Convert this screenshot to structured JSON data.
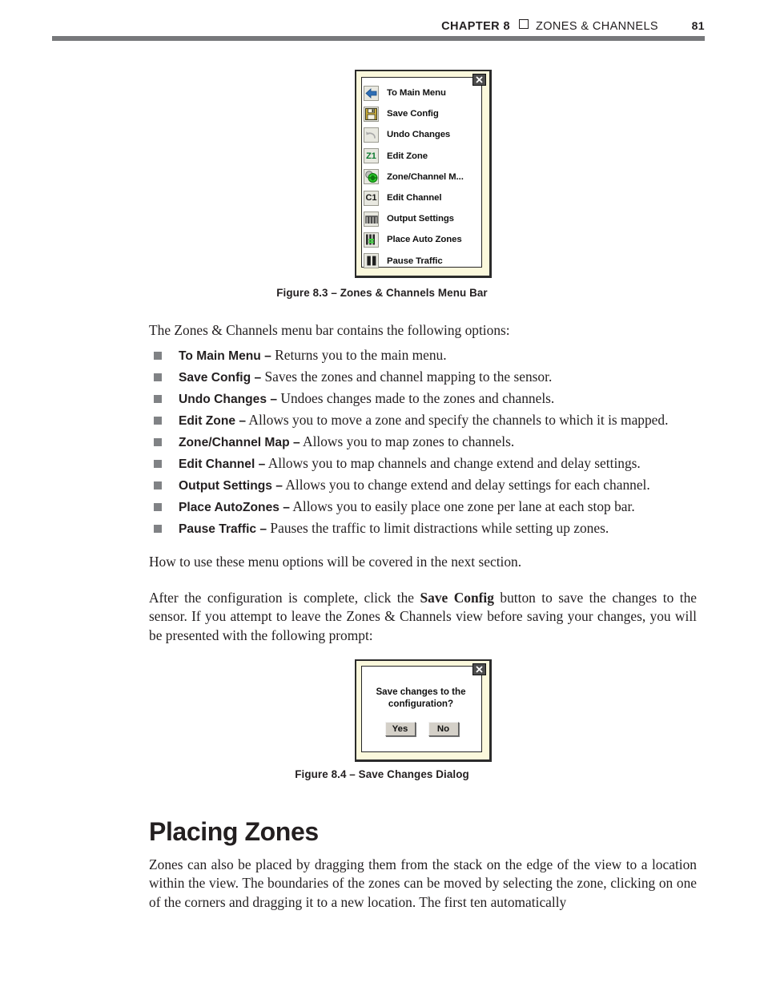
{
  "header": {
    "chapter": "CHAPTER 8",
    "separator_icon": "square-outline-icon",
    "title": "ZONES & CHANNELS",
    "page_number": "81"
  },
  "figure_menu": {
    "close_icon": "close-icon",
    "items": [
      {
        "icon": "back-arrow-icon",
        "icon_text": "",
        "label": "To Main Menu"
      },
      {
        "icon": "floppy-save-icon",
        "icon_text": "",
        "label": "Save Config"
      },
      {
        "icon": "undo-arrow-icon",
        "icon_text": "",
        "label": "Undo Changes"
      },
      {
        "icon": "zone-z1-icon",
        "icon_text": "Z1",
        "label": "Edit Zone"
      },
      {
        "icon": "zone-channel-map-icon",
        "icon_text": "",
        "label": "Zone/Channel M..."
      },
      {
        "icon": "channel-c1-icon",
        "icon_text": "C1",
        "label": "Edit Channel"
      },
      {
        "icon": "output-settings-icon",
        "icon_text": "",
        "label": "Output Settings"
      },
      {
        "icon": "place-auto-zones-icon",
        "icon_text": "",
        "label": "Place Auto Zones"
      },
      {
        "icon": "pause-traffic-icon",
        "icon_text": "",
        "label": "Pause Traffic"
      }
    ]
  },
  "caption_83": "Figure 8.3 – Zones & Channels Menu Bar",
  "intro_paragraph": "The Zones & Channels menu bar contains the following options:",
  "options": [
    {
      "term": "To Main Menu –",
      "desc": " Returns you to the main menu."
    },
    {
      "term": "Save Config –",
      "desc": " Saves the zones and channel mapping to the sensor."
    },
    {
      "term": "Undo Changes –",
      "desc": " Undoes changes made to the zones and channels."
    },
    {
      "term": "Edit Zone –",
      "desc": " Allows you to move a zone and specify the channels to which it is mapped."
    },
    {
      "term": "Zone/Channel Map –",
      "desc": " Allows you to map zones to channels."
    },
    {
      "term": "Edit Channel –",
      "desc": " Allows you to map channels and change extend and delay settings."
    },
    {
      "term": "Output Settings –",
      "desc": " Allows you to change extend and delay settings for each channel."
    },
    {
      "term": "Place AutoZones –",
      "desc": " Allows you to easily place one zone per lane at each stop bar."
    },
    {
      "term": "Pause Traffic –",
      "desc": " Pauses the traffic to limit distractions while setting up zones."
    }
  ],
  "paragraph_how": "How to use these menu options will be covered in the next section.",
  "paragraph_after": {
    "part1": "After the configuration is complete, click the ",
    "bold": "Save Config",
    "part2": " button to save the changes to the sensor. If you attempt to leave the Zones & Channels view before saving your changes, you will be presented with the following prompt:"
  },
  "figure_dialog": {
    "close_icon": "close-icon",
    "message_line1": "Save changes to the",
    "message_line2": "configuration?",
    "yes_label": "Yes",
    "no_label": "No"
  },
  "caption_84": "Figure 8.4 – Save Changes Dialog",
  "section_heading": "Placing Zones",
  "paragraph_closing": "Zones can also be placed by dragging them from the stack on the edge of the view to a location within the view. The boundaries of the zones can be moved by selecting the zone, clicking on one of the corners and dragging it to a new location. The first ten automatically",
  "colors": {
    "rule": "#77787b",
    "bullet": "#808285",
    "figure_bg": "#fbf8dc",
    "text": "#231f20",
    "accent_green": "#0b7a2f"
  }
}
